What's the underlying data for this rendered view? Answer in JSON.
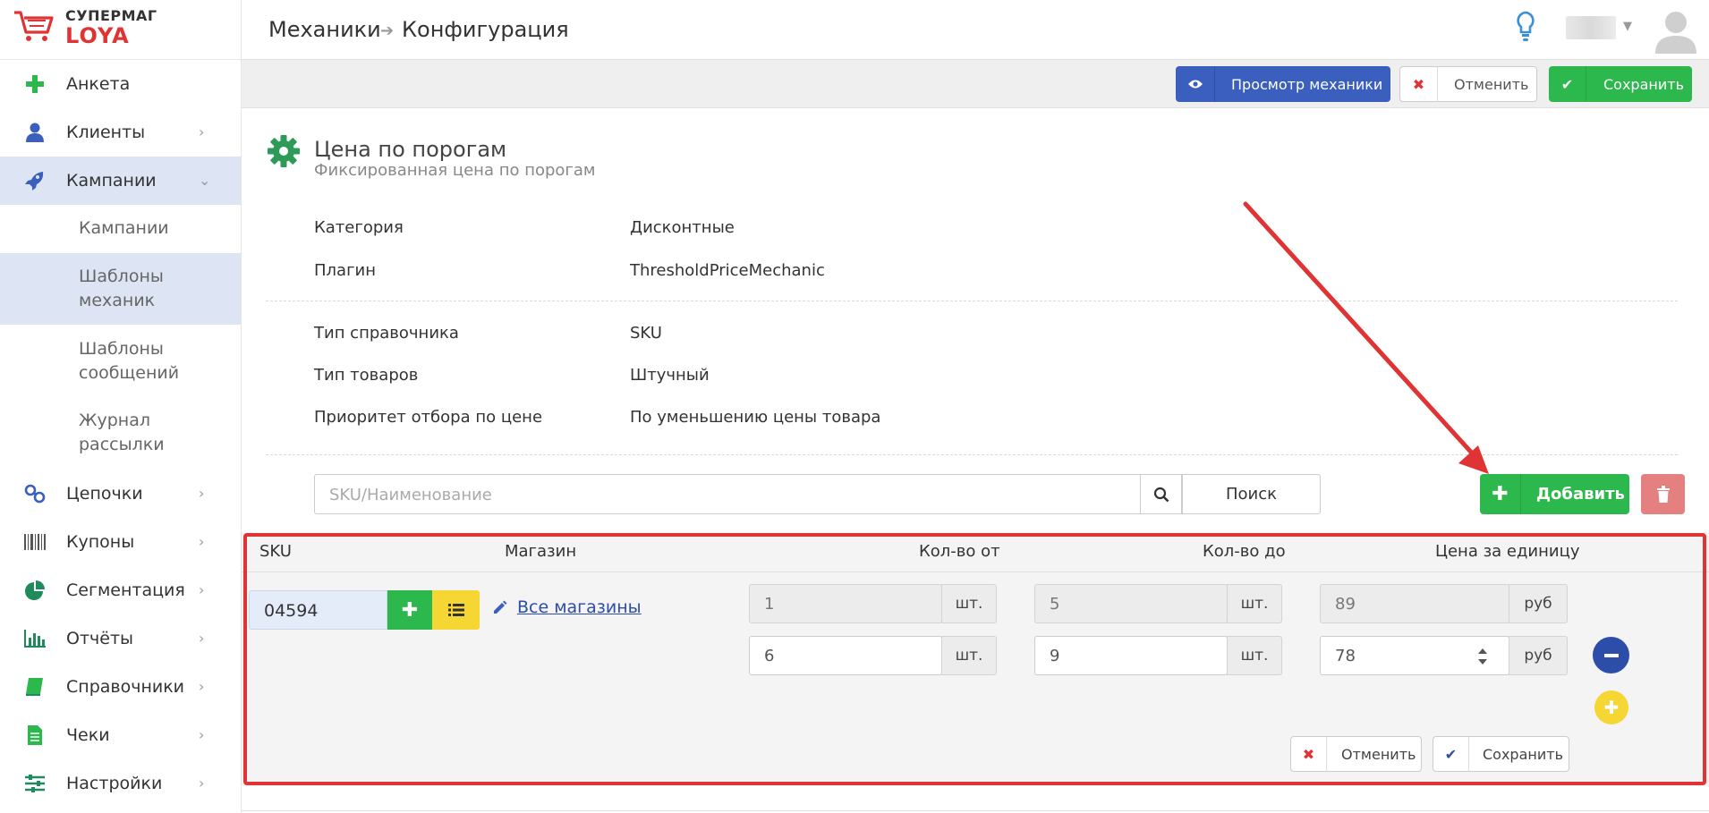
{
  "logo": {
    "line1": "СУПЕРМАГ",
    "line2": "LOYA"
  },
  "sidebar": {
    "items": [
      {
        "label": "Анкета",
        "icon": "plus-icon"
      },
      {
        "label": "Клиенты",
        "icon": "user-icon"
      },
      {
        "label": "Кампании",
        "icon": "rocket-icon"
      },
      {
        "label": "Цепочки",
        "icon": "link-icon"
      },
      {
        "label": "Купоны",
        "icon": "barcode-icon"
      },
      {
        "label": "Сегментация",
        "icon": "pie-chart-icon"
      },
      {
        "label": "Отчёты",
        "icon": "bar-chart-icon"
      },
      {
        "label": "Справочники",
        "icon": "book-icon"
      },
      {
        "label": "Чеки",
        "icon": "receipt-icon"
      },
      {
        "label": "Настройки",
        "icon": "sliders-icon"
      }
    ],
    "sub_items": [
      "Кампании",
      "Шаблоны механик",
      "Шаблоны сообщений",
      "Журнал рассылки"
    ]
  },
  "header": {
    "crumb1": "Механики",
    "crumb2": "Конфигурация"
  },
  "toolbar": {
    "view": "Просмотр механики",
    "cancel": "Отменить",
    "save": "Сохранить"
  },
  "mechanic": {
    "title": "Цена по порогам",
    "subtitle": "Фиксированная цена по порогам",
    "props": [
      {
        "label": "Категория",
        "value": "Дисконтные"
      },
      {
        "label": "Плагин",
        "value": "ThresholdPriceMechanic"
      },
      {
        "label": "Тип справочника",
        "value": "SKU"
      },
      {
        "label": "Тип товаров",
        "value": "Штучный"
      },
      {
        "label": "Приоритет отбора по цене",
        "value": "По уменьшению цены товара"
      }
    ]
  },
  "search": {
    "placeholder": "SKU/Наименование",
    "button": "Поиск"
  },
  "add_button": "Добавить",
  "table": {
    "headers": [
      "SKU",
      "Магазин",
      "Кол-во от",
      "Кол-во до",
      "Цена за единицу"
    ],
    "sku": "04594",
    "stores_link": "Все магазины",
    "rows": [
      {
        "from": "1",
        "to": "5",
        "price": "89"
      },
      {
        "from": "6",
        "to": "9",
        "price": "78"
      }
    ],
    "unit_qty": "шт.",
    "unit_price": "руб",
    "cancel": "Отменить",
    "save": "Сохранить"
  },
  "colors": {
    "green": "#2db84d",
    "blue": "#3b5fbf",
    "red": "#e03434",
    "yellow": "#f6d632"
  }
}
